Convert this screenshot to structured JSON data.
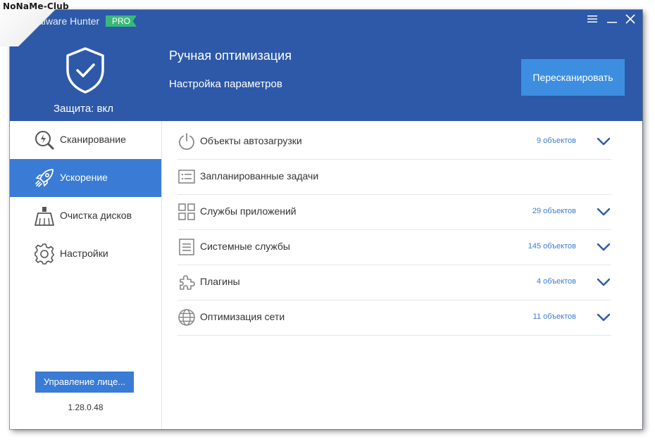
{
  "watermark": {
    "text": "NoNaMe-Club"
  },
  "header": {
    "brand": "alware Hunter",
    "badge": "PRO",
    "protection_label": "Защита: вкл",
    "title": "Ручная оптимизация",
    "subtitle": "Настройка параметров",
    "rescan_label": "Пересканировать"
  },
  "window_controls": {
    "menu_icon": "menu-icon",
    "minimize_icon": "minimize-icon",
    "close_icon": "close-icon"
  },
  "sidebar": {
    "items": [
      {
        "label": "Сканирование",
        "icon": "scan-icon",
        "active": false
      },
      {
        "label": "Ускорение",
        "icon": "rocket-icon",
        "active": true
      },
      {
        "label": "Очистка дисков",
        "icon": "broom-icon",
        "active": false
      },
      {
        "label": "Настройки",
        "icon": "gear-icon",
        "active": false
      }
    ],
    "license_label": "Управление лице...",
    "version": "1.28.0.48"
  },
  "content": {
    "rows": [
      {
        "label": "Объекты автозагрузки",
        "count": "9 объектов",
        "icon": "power-icon"
      },
      {
        "label": "Запланированные задачи",
        "count": "",
        "icon": "task-list-icon"
      },
      {
        "label": "Службы приложений",
        "count": "29 объектов",
        "icon": "grid-icon"
      },
      {
        "label": "Системные службы",
        "count": "145 объектов",
        "icon": "document-icon"
      },
      {
        "label": "Плагины",
        "count": "4 объектов",
        "icon": "puzzle-icon"
      },
      {
        "label": "Оптимизация сети",
        "count": "11 объектов",
        "icon": "globe-icon"
      }
    ]
  },
  "colors": {
    "header_bg": "#2d59a8",
    "accent": "#3a7bd5",
    "rescan_bg": "#3d8ee0",
    "badge": "#38b97a"
  }
}
